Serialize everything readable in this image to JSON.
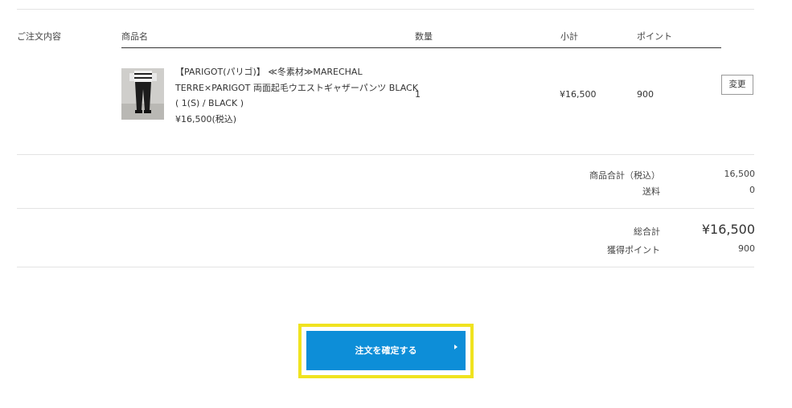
{
  "order": {
    "section_label": "ご注文内容",
    "headers": {
      "product": "商品名",
      "quantity": "数量",
      "subtotal": "小計",
      "points": "ポイント"
    },
    "item": {
      "name_line1": "【PARIGOT(パリゴ)】 ≪冬素材≫MARECHAL",
      "name_line2": "TERRE×PARIGOT 両面起毛ウエストギャザーパンツ BLACK",
      "variant": "( 1(S) / BLACK )",
      "price": "¥16,500(税込)",
      "quantity": "1",
      "subtotal": "¥16,500",
      "points": "900",
      "change_label": "変更",
      "thumbnail_icon": "product-photo-pants"
    }
  },
  "summary": {
    "merch_total_label": "商品合計（税込）",
    "merch_total_value": "16,500",
    "shipping_label": "送料",
    "shipping_value": "0",
    "grand_total_label": "総合計",
    "grand_total_value": "¥16,500",
    "earned_points_label": "獲得ポイント",
    "earned_points_value": "900"
  },
  "actions": {
    "confirm_label": "注文を確定する"
  },
  "colors": {
    "confirm_button": "#0d8ed8",
    "highlight_frame": "#f0e31f"
  }
}
